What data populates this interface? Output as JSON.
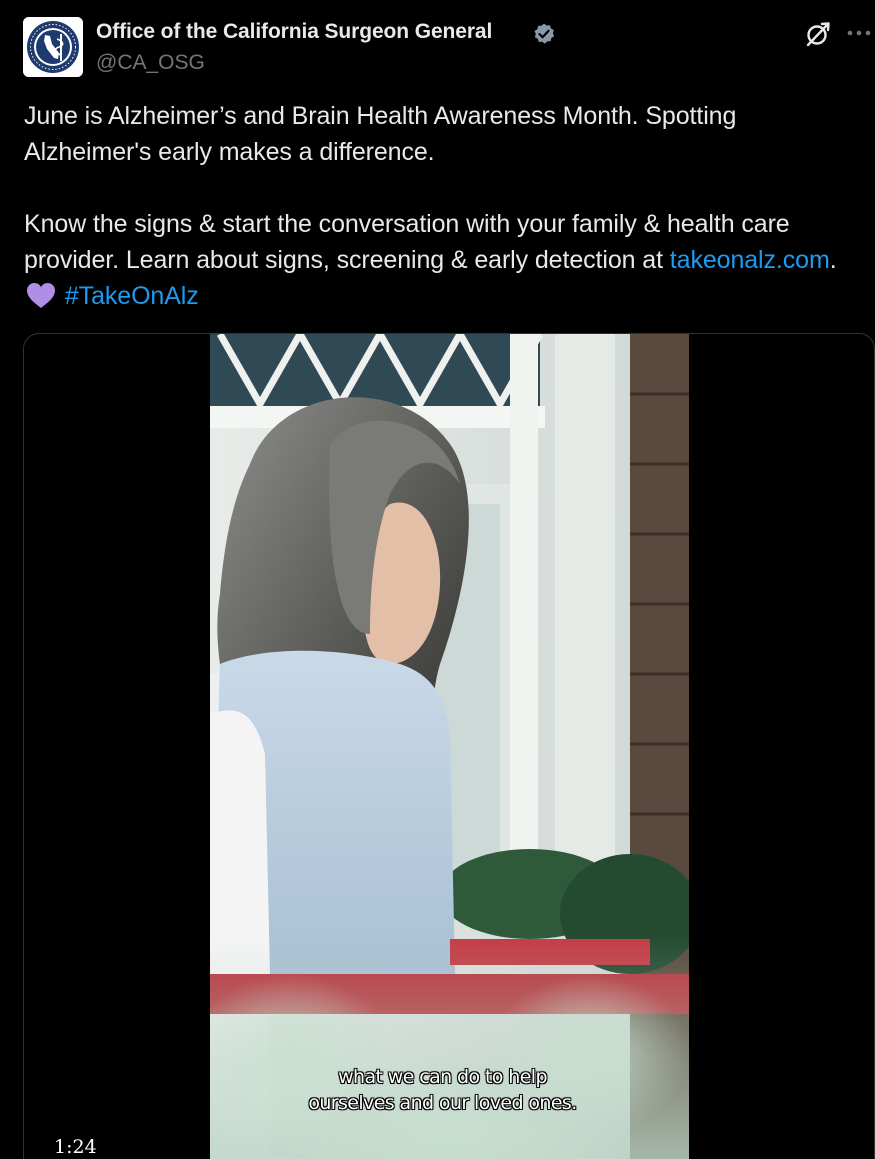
{
  "author": {
    "name": "Office of the California Surgeon General",
    "handle": "@CA_OSG",
    "verified": true,
    "avatar_icon": "california-surgeon-general-seal-icon"
  },
  "header_actions": {
    "grok_icon": "grok-icon",
    "more_icon": "more-icon"
  },
  "tweet": {
    "paragraph1": "June is Alzheimer’s and Brain Health Awareness Month. Spotting Alzheimer's early makes a difference.",
    "paragraph2_text": "Know the signs & start the conversation with your family & health care provider. Learn about signs, screening & early detection at ",
    "link": "takeonalz.com",
    "after_link": ".",
    "emoji": "purple-heart-icon",
    "hashtag": "#TakeOnAlz"
  },
  "media": {
    "caption_line1": "what we can do to help",
    "caption_line2": "ourselves and our loved ones.",
    "duration": "1:24"
  },
  "colors": {
    "background": "#000000",
    "text": "#e7e9ea",
    "secondary_text": "#71767b",
    "link": "#1d9bf0",
    "verified_badge": "#8b98a5",
    "heart": "#b08ee6"
  }
}
